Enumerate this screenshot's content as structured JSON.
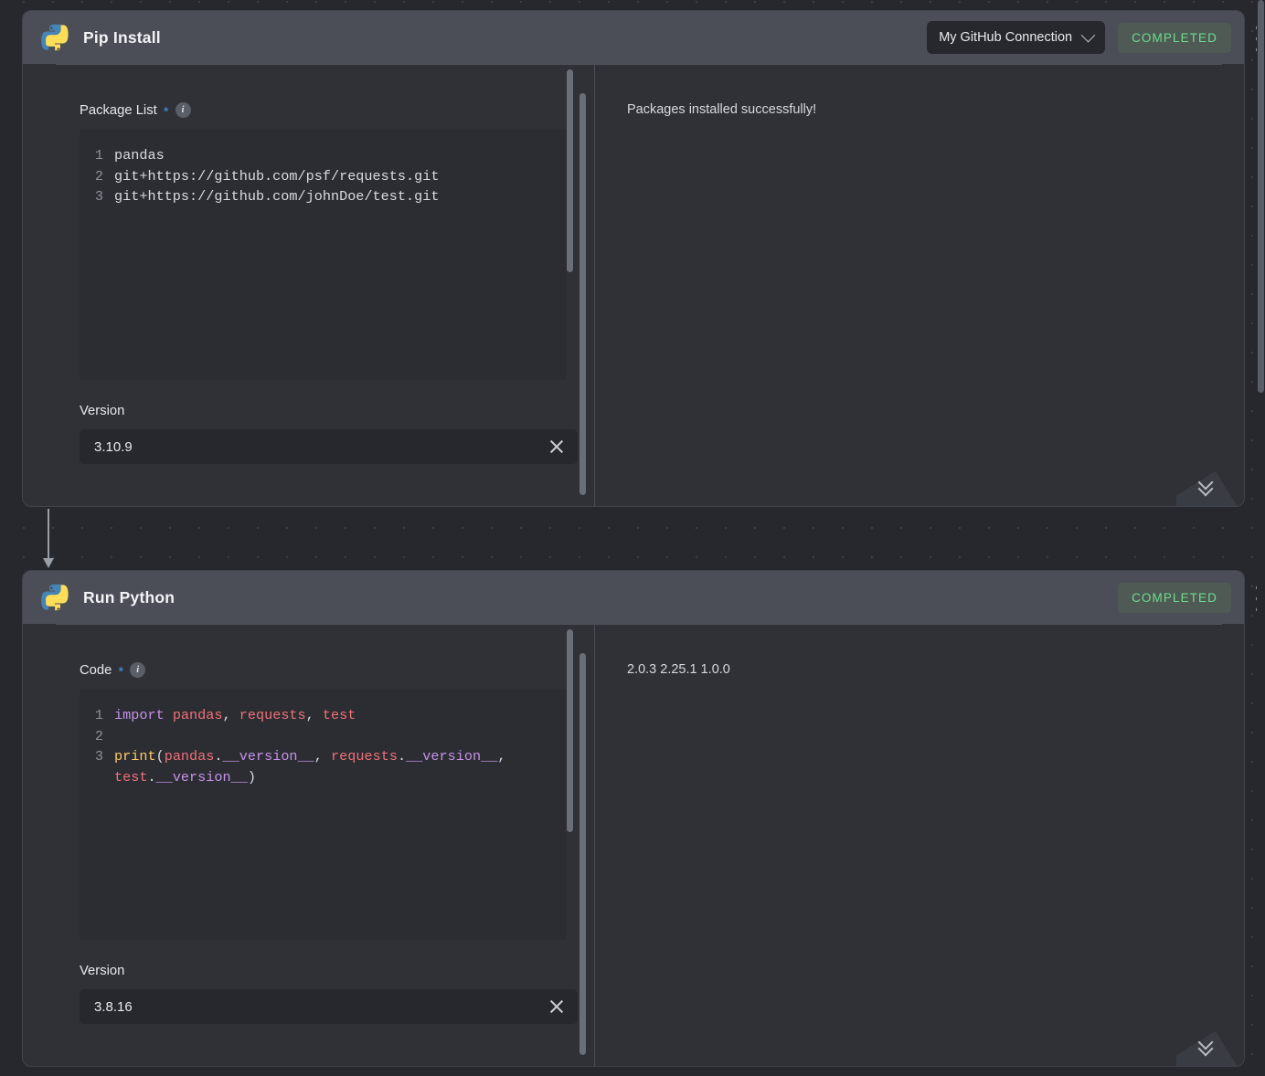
{
  "canvas": {
    "background_color": "#26282d",
    "grid": "dotted"
  },
  "nodes": [
    {
      "id": "pip-install",
      "title": "Pip Install",
      "icon": "python-logo-icon",
      "connection": {
        "label": "My GitHub Connection",
        "chevron": "chevron-down-icon"
      },
      "status": "COMPLETED",
      "status_color": "#6fdb8f",
      "fields": {
        "code_label": "Package List",
        "required_marker": "*",
        "info_icon": "i",
        "code_lines": [
          {
            "n": "1",
            "plain": "pandas"
          },
          {
            "n": "2",
            "plain": "git+https://github.com/psf/requests.git"
          },
          {
            "n": "3",
            "plain": "git+https://github.com/johnDoe/test.git"
          }
        ],
        "version_label": "Version",
        "version_value": "3.10.9",
        "clear_icon": "close-icon"
      },
      "output": "Packages installed successfully!",
      "expand_icon": "chevrons-down-icon",
      "menu_icon": "kebab-menu-icon"
    },
    {
      "id": "run-python",
      "title": "Run Python",
      "icon": "python-logo-icon",
      "connection": null,
      "status": "COMPLETED",
      "status_color": "#6fdb8f",
      "fields": {
        "code_label": "Code",
        "required_marker": "*",
        "info_icon": "i",
        "code_lines": [
          {
            "n": "1",
            "plain": "import pandas, requests, test"
          },
          {
            "n": "2",
            "plain": ""
          },
          {
            "n": "3",
            "plain": "print(pandas.__version__, requests.__version__, test.__version__)"
          }
        ],
        "version_label": "Version",
        "version_value": "3.8.16",
        "clear_icon": "close-icon"
      },
      "output": "2.0.3 2.25.1 1.0.0",
      "expand_icon": "chevrons-down-icon",
      "menu_icon": "kebab-menu-icon"
    }
  ]
}
